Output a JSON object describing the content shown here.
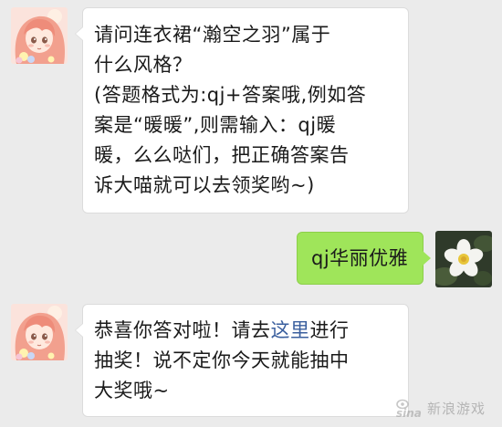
{
  "messages": [
    {
      "sender": "incoming",
      "avatar_icon": "anime-girl-avatar-icon",
      "lines": [
        "请问连衣裙“瀚空之羽”属于",
        "什么风格？",
        "(答题格式为:qj+答案哦,例如答",
        "案是“暖暖”,则需输入：qj暖",
        "暖，么么哒们，把正确答案告",
        "诉大喵就可以去领奖哟~)"
      ]
    },
    {
      "sender": "outgoing",
      "avatar_icon": "white-flower-avatar-icon",
      "text": "qj华丽优雅"
    },
    {
      "sender": "incoming",
      "avatar_icon": "anime-girl-avatar-icon",
      "line1_before": "恭喜你答对啦！请去",
      "line1_link": "这里",
      "line1_after": "进行",
      "line2": "抽奖！说不定你今天就能抽中",
      "line3": "大奖哦~"
    }
  ],
  "watermark": {
    "logo_text": "sina",
    "text": "新浪游戏"
  },
  "colors": {
    "background": "#ebebeb",
    "incoming_bubble": "#ffffff",
    "outgoing_bubble": "#9fe55a",
    "link": "#3a5f9e"
  }
}
